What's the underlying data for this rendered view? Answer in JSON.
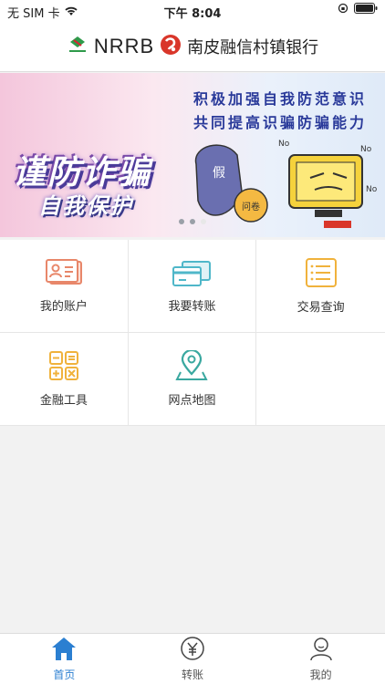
{
  "status_bar": {
    "carrier": "无 SIM 卡",
    "time": "下午 8:04"
  },
  "header": {
    "logo_text": "NRRB",
    "bank_name": "南皮融信村镇银行"
  },
  "banner": {
    "slogan_line1": "积极加强自我防范意识",
    "slogan_line2": "共同提高识骗防骗能力",
    "main_title": "谨防诈骗",
    "sub_title": "自我保护"
  },
  "menu": {
    "items": [
      {
        "label": "我的账户",
        "icon": "account-card-icon"
      },
      {
        "label": "我要转账",
        "icon": "transfer-cards-icon"
      },
      {
        "label": "交易查询",
        "icon": "transaction-list-icon"
      },
      {
        "label": "金融工具",
        "icon": "calculator-icon"
      },
      {
        "label": "网点地图",
        "icon": "map-pin-icon"
      }
    ]
  },
  "tabbar": {
    "items": [
      {
        "label": "首页",
        "icon": "home-icon",
        "active": true
      },
      {
        "label": "转账",
        "icon": "yuan-icon",
        "active": false
      },
      {
        "label": "我的",
        "icon": "user-icon",
        "active": false
      }
    ]
  },
  "colors": {
    "accent": "#2b7fd1",
    "account_icon": "#e8876a",
    "transfer_icon": "#4fb7c9",
    "query_icon": "#f0b23c",
    "tool_icon": "#f0b23c",
    "map_icon": "#3aa8a0"
  }
}
